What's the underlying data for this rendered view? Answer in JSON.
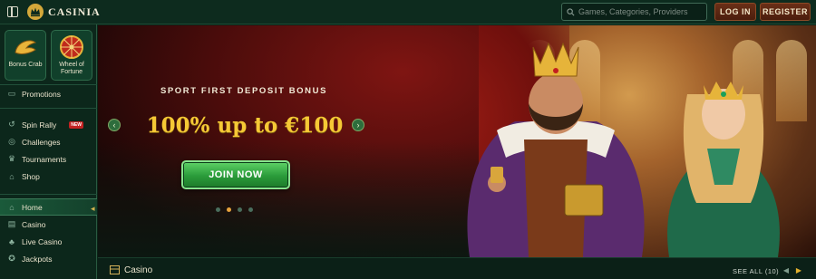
{
  "header": {
    "brand": "CASINIA",
    "search_placeholder": "Games, Categories, Providers",
    "login_label": "LOG IN",
    "register_label": "REGISTER"
  },
  "sidebar": {
    "tiles": [
      {
        "label": "Bonus Crab",
        "icon": "crab-claw-icon"
      },
      {
        "label": "Wheel of Fortune",
        "icon": "fortune-wheel-icon"
      }
    ],
    "items": [
      {
        "label": "Promotions",
        "icon": "gift-icon"
      },
      {
        "label": "Spin Rally",
        "icon": "rally-icon",
        "badge": "NEW"
      },
      {
        "label": "Challenges",
        "icon": "target-icon"
      },
      {
        "label": "Tournaments",
        "icon": "trophy-icon"
      },
      {
        "label": "Shop",
        "icon": "shop-icon"
      },
      {
        "label": "Home",
        "icon": "home-icon",
        "active": true
      },
      {
        "label": "Casino",
        "icon": "casino-icon"
      },
      {
        "label": "Live Casino",
        "icon": "live-casino-icon"
      },
      {
        "label": "Jackpots",
        "icon": "jackpot-icon"
      }
    ]
  },
  "hero": {
    "subtitle": "SPORT FIRST DEPOSIT BONUS",
    "title": "100% up to €100",
    "cta": "JOIN NOW",
    "slide_count": 4,
    "active_slide": 2
  },
  "section": {
    "title": "Casino",
    "see_all": "SEE ALL (10)"
  },
  "colors": {
    "background": "#0b2318",
    "accent_gold": "#f5c835",
    "cta_green": "#2a9b3a",
    "button_brown": "#5b2612"
  }
}
